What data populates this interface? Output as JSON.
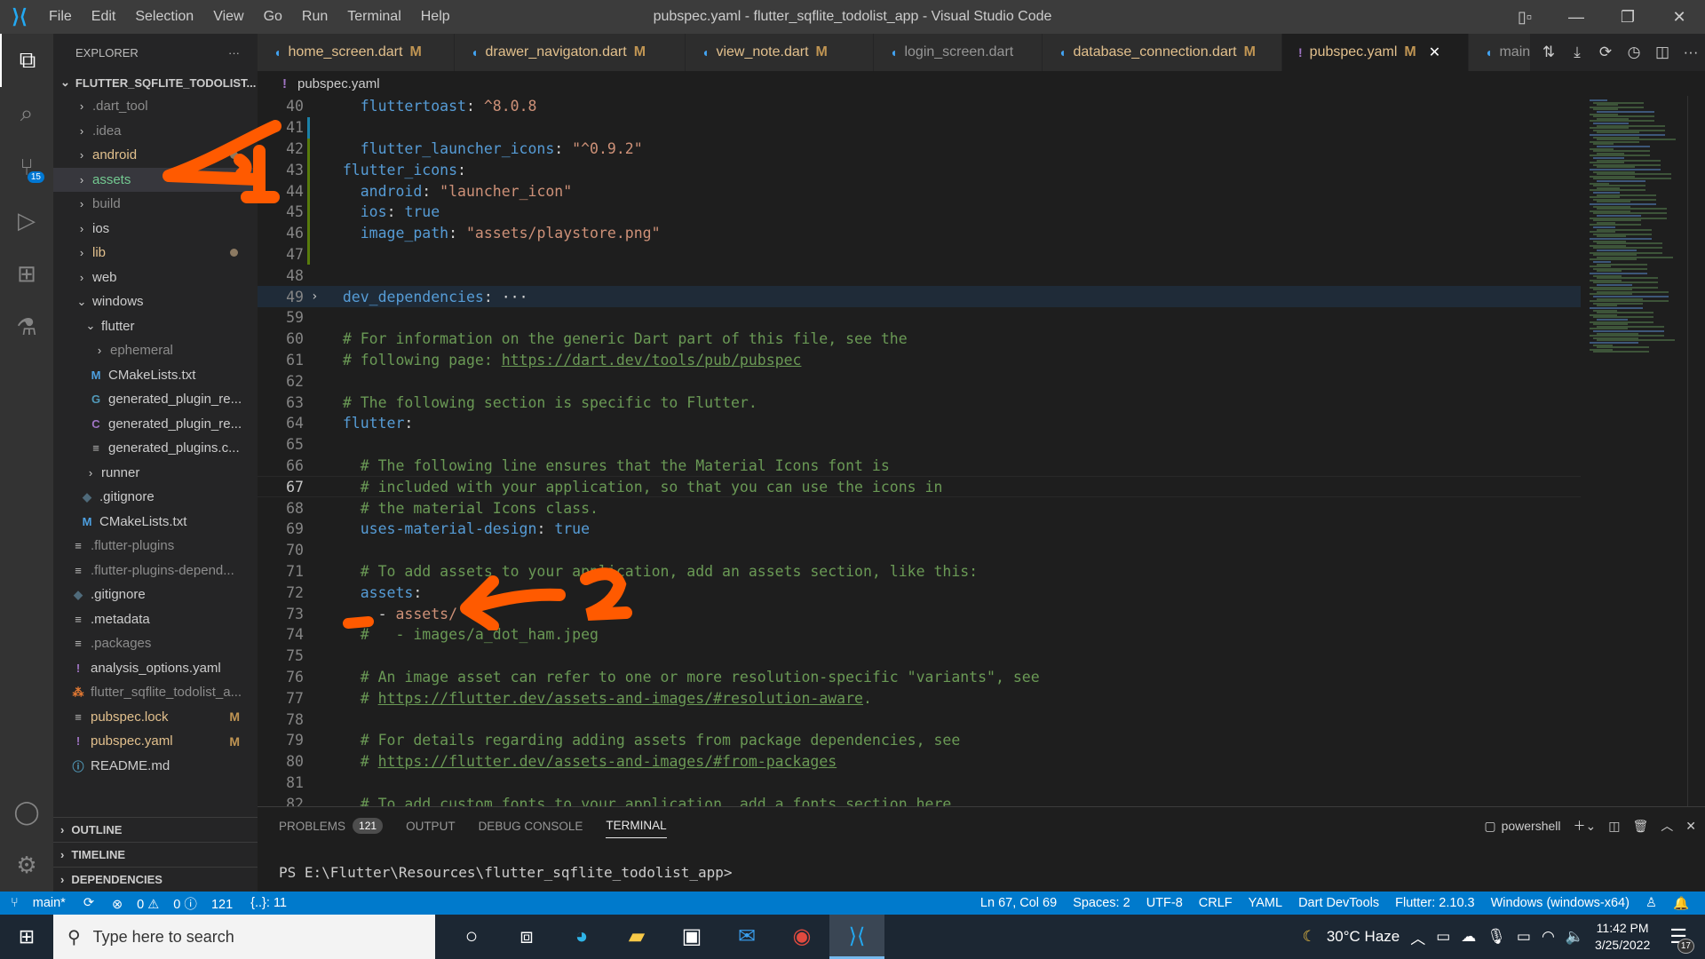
{
  "titlebar": {
    "menu": [
      "File",
      "Edit",
      "Selection",
      "View",
      "Go",
      "Run",
      "Terminal",
      "Help"
    ],
    "title": "pubspec.yaml - flutter_sqflite_todolist_app - Visual Studio Code"
  },
  "activity": {
    "scm_badge": "15"
  },
  "sidebar": {
    "header": "EXPLORER",
    "more": "···",
    "root": "FLUTTER_SQFLITE_TODOLIST...",
    "items": [
      {
        "label": ".dart_tool",
        "type": "folder",
        "state": "ignored"
      },
      {
        "label": ".idea",
        "type": "folder",
        "state": "ignored"
      },
      {
        "label": "android",
        "type": "folder",
        "state": "modified",
        "dot": true
      },
      {
        "label": "assets",
        "type": "folder",
        "state": "new"
      },
      {
        "label": "build",
        "type": "folder",
        "state": "ignored"
      },
      {
        "label": "ios",
        "type": "folder",
        "state": "normal"
      },
      {
        "label": "lib",
        "type": "folder",
        "state": "modified",
        "dot": true
      },
      {
        "label": "web",
        "type": "folder",
        "state": "normal"
      },
      {
        "label": "windows",
        "type": "folder-open",
        "state": "normal"
      },
      {
        "label": "flutter",
        "type": "folder-open",
        "state": "normal"
      },
      {
        "label": "ephemeral",
        "type": "folder",
        "state": "ignored"
      },
      {
        "label": "CMakeLists.txt",
        "type": "file",
        "icon": "M",
        "state": "normal"
      },
      {
        "label": "generated_plugin_re...",
        "type": "file",
        "icon": "C+",
        "state": "normal"
      },
      {
        "label": "generated_plugin_re...",
        "type": "file",
        "icon": "C",
        "state": "normal"
      },
      {
        "label": "generated_plugins.c...",
        "type": "file",
        "icon": "≡",
        "state": "normal"
      },
      {
        "label": "runner",
        "type": "folder",
        "state": "normal"
      },
      {
        "label": ".gitignore",
        "type": "file",
        "icon": "◆",
        "state": "normal"
      },
      {
        "label": "CMakeLists.txt",
        "type": "file",
        "icon": "M",
        "state": "normal"
      },
      {
        "label": ".flutter-plugins",
        "type": "file",
        "icon": "≡",
        "state": "ignored"
      },
      {
        "label": ".flutter-plugins-depend...",
        "type": "file",
        "icon": "≡",
        "state": "ignored"
      },
      {
        "label": ".gitignore",
        "type": "file",
        "icon": "◆",
        "state": "normal"
      },
      {
        "label": ".metadata",
        "type": "file",
        "icon": "≡",
        "state": "normal"
      },
      {
        "label": ".packages",
        "type": "file",
        "icon": "≡",
        "state": "ignored"
      },
      {
        "label": "analysis_options.yaml",
        "type": "file",
        "icon": "!",
        "state": "normal"
      },
      {
        "label": "flutter_sqflite_todolist_a...",
        "type": "file",
        "icon": "rss",
        "state": "ignored"
      },
      {
        "label": "pubspec.lock",
        "type": "file",
        "icon": "≡",
        "state": "modified",
        "flag": "M"
      },
      {
        "label": "pubspec.yaml",
        "type": "file",
        "icon": "!",
        "state": "modified",
        "flag": "M"
      },
      {
        "label": "README.md",
        "type": "file",
        "icon": "ⓘ",
        "state": "normal"
      }
    ],
    "sections": [
      "OUTLINE",
      "TIMELINE",
      "DEPENDENCIES"
    ]
  },
  "tabs": [
    {
      "label": "home_screen.dart",
      "flag": "M"
    },
    {
      "label": "drawer_navigaton.dart",
      "flag": "M"
    },
    {
      "label": "view_note.dart",
      "flag": "M"
    },
    {
      "label": "login_screen.dart",
      "flag": ""
    },
    {
      "label": "database_connection.dart",
      "flag": "M"
    },
    {
      "label": "pubspec.yaml",
      "flag": "M",
      "active": true
    },
    {
      "label": "main",
      "flag": ""
    }
  ],
  "breadcrumb": "pubspec.yaml",
  "editor": {
    "cursor_line": 67,
    "lines": [
      {
        "n": "40",
        "html": "    <span class='k'>fluttertoast</span><span class='p'>: </span><span class='n'>^8.0.8</span>",
        "g": ""
      },
      {
        "n": "41",
        "html": "",
        "g": "mod"
      },
      {
        "n": "42",
        "html": "    <span class='k'>flutter_launcher_icons</span><span class='p'>: </span><span class='s'>\"^0.9.2\"</span>",
        "g": "add"
      },
      {
        "n": "43",
        "html": "  <span class='k'>flutter_icons</span><span class='p'>:</span>",
        "g": "add"
      },
      {
        "n": "44",
        "html": "    <span class='k'>android</span><span class='p'>: </span><span class='s'>\"launcher_icon\"</span>",
        "g": "add"
      },
      {
        "n": "45",
        "html": "    <span class='k'>ios</span><span class='p'>: </span><span class='b'>true</span>",
        "g": "add"
      },
      {
        "n": "46",
        "html": "    <span class='k'>image_path</span><span class='p'>: </span><span class='s'>\"assets/playstore.png\"</span>",
        "g": "add"
      },
      {
        "n": "47",
        "html": "",
        "g": "add"
      },
      {
        "n": "48",
        "html": "",
        "g": ""
      },
      {
        "n": "49",
        "html": "  <span class='k'>dev_dependencies</span><span class='p'>:</span><span class='p'> ···</span>",
        "g": "",
        "fold": true
      },
      {
        "n": "59",
        "html": "",
        "g": ""
      },
      {
        "n": "60",
        "html": "  <span class='cm'># For information on the generic Dart part of this file, see the</span>",
        "g": ""
      },
      {
        "n": "61",
        "html": "  <span class='cm'># following page: <span class='u'>https://dart.dev/tools/pub/pubspec</span></span>",
        "g": ""
      },
      {
        "n": "62",
        "html": "",
        "g": ""
      },
      {
        "n": "63",
        "html": "  <span class='cm'># The following section is specific to Flutter.</span>",
        "g": ""
      },
      {
        "n": "64",
        "html": "  <span class='k'>flutter</span><span class='p'>:</span>",
        "g": ""
      },
      {
        "n": "65",
        "html": "",
        "g": ""
      },
      {
        "n": "66",
        "html": "    <span class='cm'># The following line ensures that the Material Icons font is</span>",
        "g": ""
      },
      {
        "n": "67",
        "html": "    <span class='cm'># included with your application, so that you can use the icons in</span>",
        "g": ""
      },
      {
        "n": "68",
        "html": "    <span class='cm'># the material Icons class.</span>",
        "g": ""
      },
      {
        "n": "69",
        "html": "    <span class='k'>uses-material-design</span><span class='p'>: </span><span class='b'>true</span>",
        "g": ""
      },
      {
        "n": "70",
        "html": "",
        "g": ""
      },
      {
        "n": "71",
        "html": "    <span class='cm'># To add assets to your application, add an assets section, like this:</span>",
        "g": ""
      },
      {
        "n": "72",
        "html": "    <span class='k'>assets</span><span class='p'>:</span>",
        "g": ""
      },
      {
        "n": "73",
        "html": "      <span class='p'>- </span><span class='s'>assets/</span>",
        "g": ""
      },
      {
        "n": "74",
        "html": "    <span class='cm'>#   - images/a_dot_ham.jpeg</span>",
        "g": ""
      },
      {
        "n": "75",
        "html": "",
        "g": ""
      },
      {
        "n": "76",
        "html": "    <span class='cm'># An image asset can refer to one or more resolution-specific \"variants\", see</span>",
        "g": ""
      },
      {
        "n": "77",
        "html": "    <span class='cm'># <span class='u'>https://flutter.dev/assets-and-images/#resolution-aware</span>.</span>",
        "g": ""
      },
      {
        "n": "78",
        "html": "",
        "g": ""
      },
      {
        "n": "79",
        "html": "    <span class='cm'># For details regarding adding assets from package dependencies, see</span>",
        "g": ""
      },
      {
        "n": "80",
        "html": "    <span class='cm'># <span class='u'>https://flutter.dev/assets-and-images/#from-packages</span></span>",
        "g": ""
      },
      {
        "n": "81",
        "html": "",
        "g": ""
      },
      {
        "n": "82",
        "html": "    <span class='cm'># To add custom fonts to your application, add a fonts section here,</span>",
        "g": ""
      }
    ]
  },
  "panel": {
    "tabs": [
      {
        "label": "PROBLEMS",
        "badge": "121"
      },
      {
        "label": "OUTPUT"
      },
      {
        "label": "DEBUG CONSOLE"
      },
      {
        "label": "TERMINAL",
        "active": true
      }
    ],
    "shell": "powershell",
    "prompt": "PS E:\\Flutter\\Resources\\flutter_sqflite_todolist_app>"
  },
  "statusbar": {
    "branch": "main*",
    "errors": "0",
    "warnings": "0",
    "infos": "121",
    "braces": "{..}: 11",
    "position": "Ln 67, Col 69",
    "spaces": "Spaces: 2",
    "encoding": "UTF-8",
    "eol": "CRLF",
    "language": "YAML",
    "devtools": "Dart DevTools",
    "flutter": "Flutter: 2.10.3",
    "device": "Windows (windows-x64)"
  },
  "taskbar": {
    "search_placeholder": "Type here to search",
    "weather": "30°C  Haze",
    "time": "11:42 PM",
    "date": "3/25/2022",
    "notifications": "17"
  },
  "annotations": [
    "1",
    "2"
  ],
  "colors": {
    "accent": "#007acc",
    "annotation": "#ff5a00"
  }
}
